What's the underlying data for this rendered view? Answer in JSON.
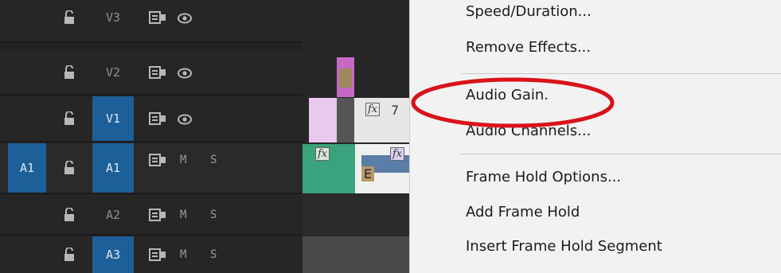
{
  "tracks": [
    {
      "source": "",
      "lock_icon": "lock-open-icon",
      "target": "V3",
      "target_active": false,
      "type": "video",
      "sync_icon": "sync-lock-icon",
      "eye_icon": "eye-icon"
    },
    {
      "source": "",
      "lock_icon": "lock-open-icon",
      "target": "V2",
      "target_active": false,
      "type": "video",
      "sync_icon": "sync-lock-icon",
      "eye_icon": "eye-icon"
    },
    {
      "source": "",
      "lock_icon": "lock-open-icon",
      "target": "V1",
      "target_active": true,
      "type": "video",
      "sync_icon": "sync-lock-icon",
      "eye_icon": "eye-icon"
    },
    {
      "source": "A1",
      "lock_icon": "lock-open-icon",
      "target": "A1",
      "target_active": true,
      "type": "audio",
      "mute": "M",
      "solo": "S"
    },
    {
      "source": "",
      "lock_icon": "lock-open-icon",
      "target": "A2",
      "target_active": false,
      "type": "audio",
      "mute": "M",
      "solo": "S"
    },
    {
      "source": "",
      "lock_icon": "lock-open-icon",
      "target": "A3",
      "target_active": true,
      "type": "audio",
      "mute": "M",
      "solo": "S"
    }
  ],
  "clips": {
    "v1_fx": "fx",
    "v1_label": "7",
    "a1_fx_1": "fx",
    "a1_fx_2": "fx",
    "a1_label": "E"
  },
  "context_menu": {
    "items": [
      {
        "label": "Speed/Duration..."
      },
      {
        "label": "Remove Effects..."
      },
      {
        "label": "Audio Gain."
      },
      {
        "label": "Audio Channels..."
      },
      {
        "label": "Frame Hold Options..."
      },
      {
        "label": "Add Frame Hold"
      },
      {
        "label": "Insert Frame Hold Segment"
      }
    ],
    "highlighted_item": "Audio Gain.",
    "highlight_color": "#d9121b"
  },
  "colors": {
    "track_active": "#1d5f98",
    "clip_pink": "#e9c9ee",
    "clip_magenta": "#c46ac6",
    "clip_green": "#3aa27c",
    "clip_blue": "#5b7ea8"
  }
}
